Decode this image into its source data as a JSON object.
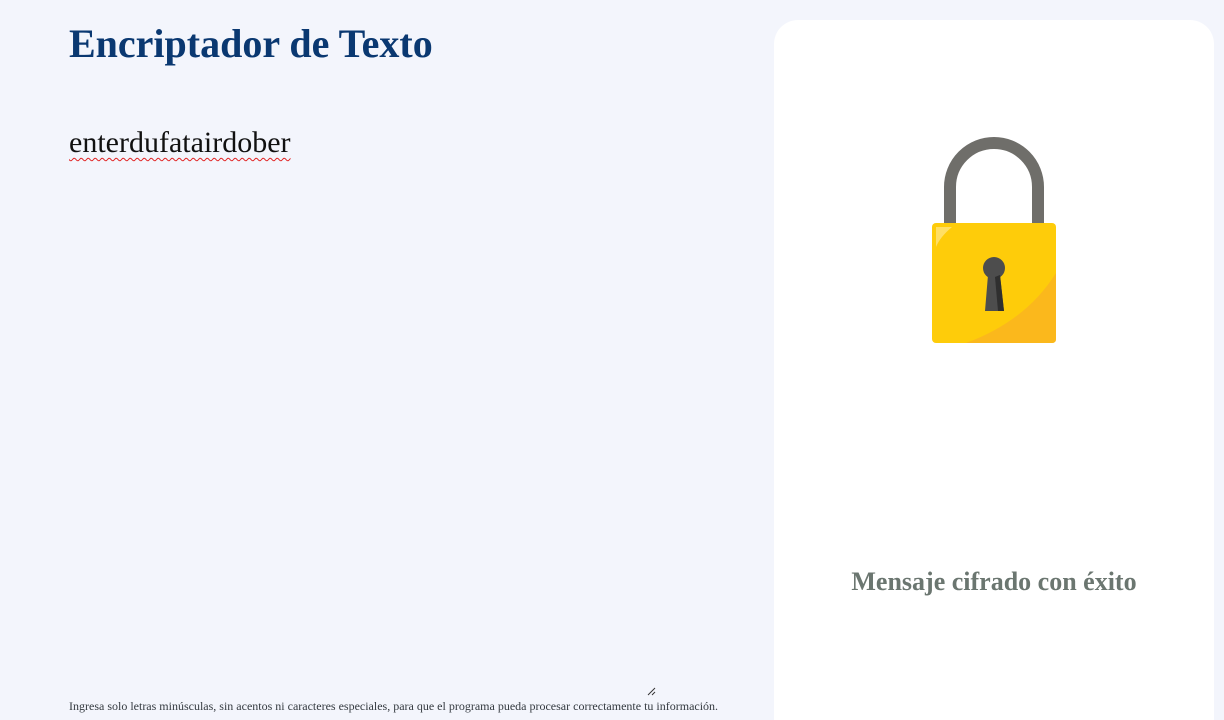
{
  "header": {
    "title": "Encriptador de Texto"
  },
  "input": {
    "value": "enterdufatairdober"
  },
  "hint": {
    "text": "Ingresa solo letras minúsculas, sin acentos ni caracteres especiales, para que el programa pueda procesar correctamente tu información."
  },
  "output": {
    "message": "Mensaje cifrado con éxito",
    "image_icon": "padlock-icon"
  },
  "colors": {
    "background": "#f3f5fc",
    "title": "#0a3871",
    "panel": "#ffffff",
    "message": "#6b7670",
    "lock_body": "#fecc0a",
    "lock_shackle": "#6f6e6a"
  }
}
